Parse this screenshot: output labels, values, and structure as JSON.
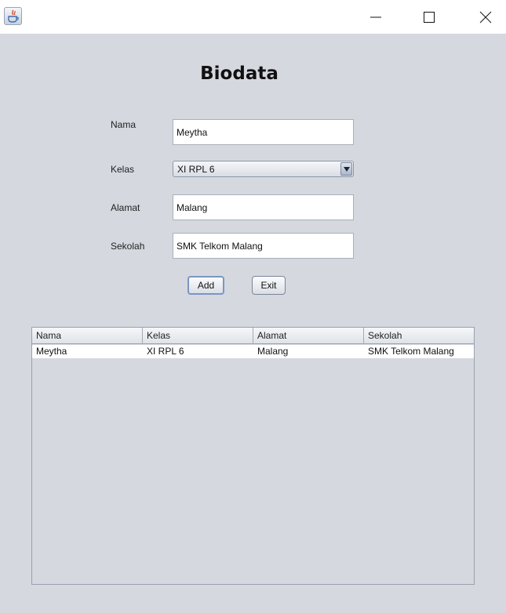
{
  "window": {
    "icon": "java-icon",
    "controls": [
      "minimize-icon",
      "maximize-icon",
      "close-icon"
    ]
  },
  "form": {
    "heading": "Biodata",
    "nama_label": "Nama",
    "nama_value": "Meytha",
    "kelas_label": "Kelas",
    "kelas_selected": "XI RPL 6",
    "alamat_label": "Alamat",
    "alamat_value": "Malang",
    "sekolah_label": "Sekolah",
    "sekolah_value": "SMK Telkom Malang",
    "add_label": "Add",
    "exit_label": "Exit"
  },
  "table": {
    "columns": [
      "Nama",
      "Kelas",
      "Alamat",
      "Sekolah"
    ],
    "rows": [
      [
        "Meytha",
        "XI RPL 6",
        "Malang",
        "SMK Telkom Malang"
      ]
    ]
  }
}
